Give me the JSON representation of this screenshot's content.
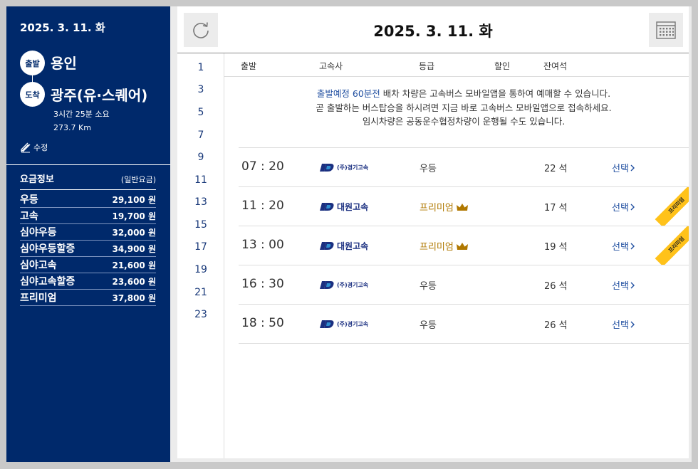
{
  "sidebar": {
    "date": "2025. 3. 11. 화",
    "departure": {
      "badge": "출발",
      "name": "용인"
    },
    "arrival": {
      "badge": "도착",
      "name": "광주(유·스퀘어)"
    },
    "duration": "3시간 25분 소요",
    "distance": "273.7 Km",
    "edit_label": "수정",
    "fare_title": "요금정보",
    "fare_type": "(일반요금)",
    "fares": [
      {
        "name": "우등",
        "price": "29,100 원"
      },
      {
        "name": "고속",
        "price": "19,700 원"
      },
      {
        "name": "심야우등",
        "price": "32,000 원"
      },
      {
        "name": "심야우등할증",
        "price": "34,900 원"
      },
      {
        "name": "심야고속",
        "price": "21,600 원"
      },
      {
        "name": "심야고속할증",
        "price": "23,600 원"
      },
      {
        "name": "프리미엄",
        "price": "37,800 원"
      }
    ]
  },
  "header": {
    "date": "2025. 3. 11. 화",
    "refresh_icon": "refresh-icon",
    "calendar_icon": "calendar-icon"
  },
  "hours": [
    "1",
    "3",
    "5",
    "7",
    "9",
    "11",
    "13",
    "15",
    "17",
    "19",
    "21",
    "23"
  ],
  "columns": {
    "departure": "출발",
    "company": "고속사",
    "grade": "등급",
    "discount": "할인",
    "seats": "잔여석"
  },
  "notice": {
    "line1_highlight": "출발예정 60분전",
    "line1_rest": " 배차 차량은 고속버스 모바일앱을 통하여 예매할 수 있습니다.",
    "line2": "곧 출발하는 버스탑승을 하시려면 지금 바로 고속버스 모바일앱으로 접속하세요.",
    "line3": "임시차량은 공동운수협정차량이 운행될 수도 있습니다."
  },
  "schedule": [
    {
      "time": "07 : 20",
      "company": "(주)경기고속",
      "grade": "우등",
      "seats": "22 석",
      "select": "선택",
      "ribbon": ""
    },
    {
      "time": "11 : 20",
      "company": "대원고속",
      "grade": "프리미엄",
      "seats": "17 석",
      "select": "선택",
      "ribbon": "프리미엄"
    },
    {
      "time": "13 : 00",
      "company": "대원고속",
      "grade": "프리미엄",
      "seats": "19 석",
      "select": "선택",
      "ribbon": "프리미엄"
    },
    {
      "time": "16 : 30",
      "company": "(주)경기고속",
      "grade": "우등",
      "seats": "26 석",
      "select": "선택",
      "ribbon": ""
    },
    {
      "time": "18 : 50",
      "company": "(주)경기고속",
      "grade": "우등",
      "seats": "26 석",
      "select": "선택",
      "ribbon": ""
    }
  ],
  "colors": {
    "sidebar_bg": "#00296b",
    "accent_blue": "#1f4ea0",
    "premium_gold": "#b07800",
    "ribbon_yellow": "#ffc21a"
  }
}
